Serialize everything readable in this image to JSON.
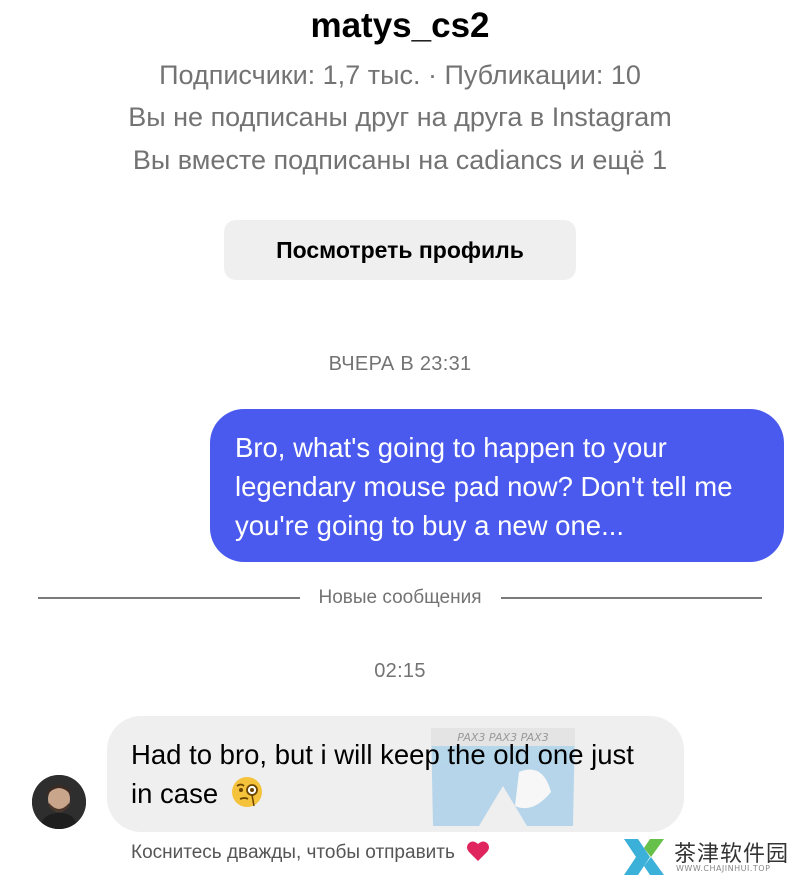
{
  "profile": {
    "username": "matys_cs2",
    "stats_line": "Подписчики: 1,7 тыс. · Публикации: 10",
    "follow_status": "Вы не подписаны друг на друга в Instagram",
    "mutual_line": "Вы вместе подписаны на cadiancs и ещё 1",
    "view_profile_label": "Посмотреть профиль"
  },
  "chat": {
    "timestamp_1": "ВЧЕРА В 23:31",
    "outgoing_message": "Bro, what's going to happen to your legendary mouse pad now? Don't tell me you're going to buy a new one...",
    "new_messages_label": "Новые сообщения",
    "timestamp_2": "02:15",
    "incoming_message": "Had to bro, but i will keep the old one just in case",
    "incoming_emoji": "face-with-monocle-icon",
    "incoming_sticker_text": "PAX3 PAX3 PAX3",
    "hint_label": "Коснитесь дважды, чтобы отправить",
    "hint_icon": "heart-icon"
  },
  "watermark": {
    "title": "茶津软件园",
    "url": "WWW.CHAJINHUI.TOP"
  },
  "colors": {
    "outgoing_bubble": "#4b5aee",
    "incoming_bubble": "#efefef",
    "secondary_text": "#737373",
    "heart": "#e0245e"
  }
}
